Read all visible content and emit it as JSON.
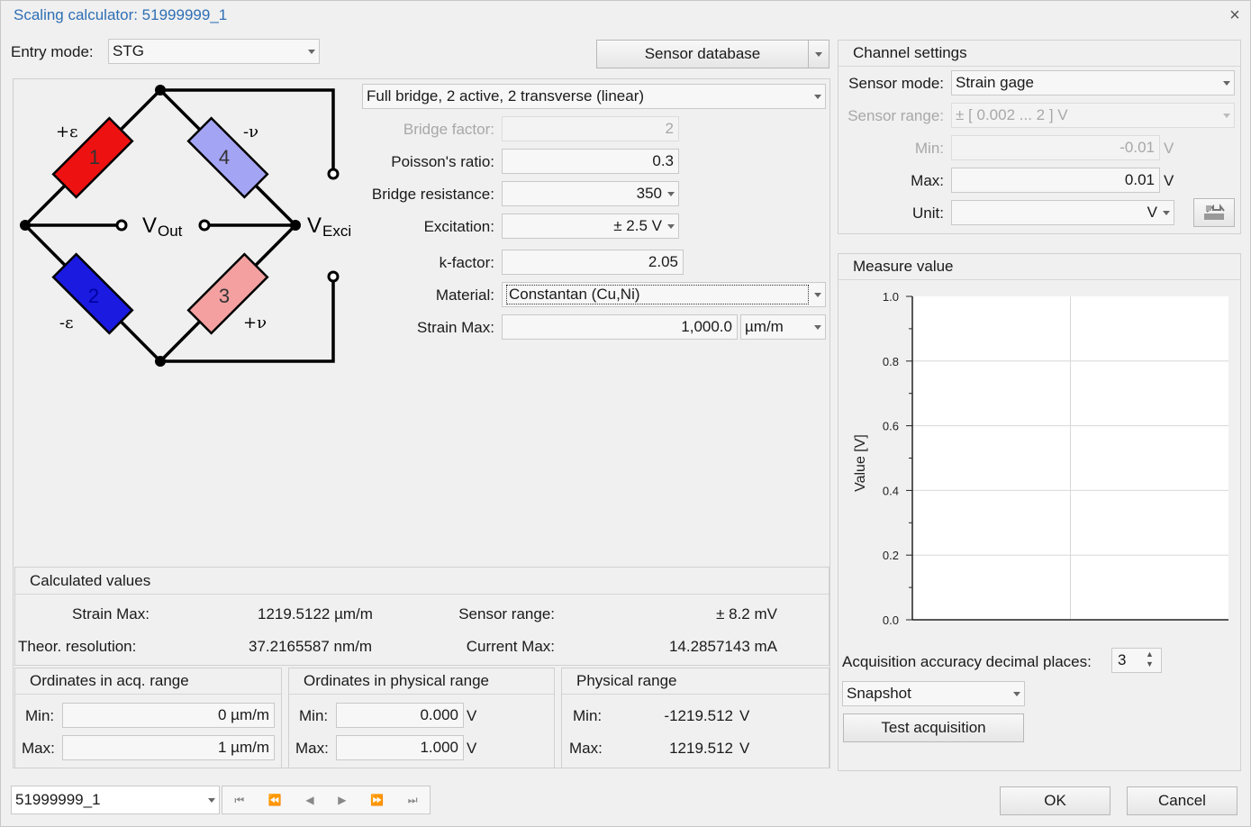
{
  "window": {
    "title": "Scaling calculator: 51999999_1",
    "close": "×"
  },
  "entry": {
    "label": "Entry mode:",
    "value": "STG"
  },
  "sensor_db": {
    "label": "Sensor database"
  },
  "bridge": {
    "type": "Full bridge, 2 active, 2 transverse (linear)",
    "diagram": {
      "g1": "1",
      "g2": "2",
      "g3": "3",
      "g4": "4",
      "pe": "+ε",
      "me": "-ε",
      "mv": "-ν",
      "pv": "+ν",
      "vout": "V",
      "vout_sub": "Out",
      "vexc": "V",
      "vexc_sub": "Exci"
    }
  },
  "params": {
    "bridge_factor": {
      "label": "Bridge factor:",
      "value": "2"
    },
    "poisson": {
      "label": "Poisson's ratio:",
      "value": "0.3"
    },
    "resistance": {
      "label": "Bridge resistance:",
      "value": "350"
    },
    "excitation": {
      "label": "Excitation:",
      "value": "± 2.5 V"
    },
    "kfactor": {
      "label": "k-factor:",
      "value": "2.05"
    },
    "material": {
      "label": "Material:",
      "value": "Constantan (Cu,Ni)"
    },
    "strain_max": {
      "label": "Strain Max:",
      "value": "1,000.0",
      "unit": "µm/m"
    }
  },
  "calc": {
    "title": "Calculated values",
    "strain_max": {
      "label": "Strain Max:",
      "value": "1219.5122 µm/m"
    },
    "resolution": {
      "label": "Theor. resolution:",
      "value": "37.2165587 nm/m"
    },
    "sensor_range": {
      "label": "Sensor range:",
      "value": "± 8.2 mV"
    },
    "current_max": {
      "label": "Current Max:",
      "value": "14.2857143 mA"
    }
  },
  "ord_acq": {
    "title": "Ordinates in acq. range",
    "min_label": "Min:",
    "min": "0 µm/m",
    "max_label": "Max:",
    "max": "1 µm/m"
  },
  "ord_phys": {
    "title": "Ordinates in physical range",
    "min_label": "Min:",
    "min": "0.000",
    "min_unit": "V",
    "max_label": "Max:",
    "max": "1.000",
    "max_unit": "V"
  },
  "phys_range": {
    "title": "Physical range",
    "min_label": "Min:",
    "min": "-1219.512",
    "min_unit": "V",
    "max_label": "Max:",
    "max": "1219.512",
    "max_unit": "V"
  },
  "channel": {
    "title": "Channel settings",
    "sensor_mode": {
      "label": "Sensor mode:",
      "value": "Strain gage"
    },
    "sensor_range": {
      "label": "Sensor range:",
      "value": "± [ 0.002 ... 2 ] V"
    },
    "min": {
      "label": "Min:",
      "value": "-0.01",
      "unit": "V"
    },
    "max": {
      "label": "Max:",
      "value": "0.01",
      "unit": "V"
    },
    "unit": {
      "label": "Unit:",
      "value": "V"
    }
  },
  "measure": {
    "title": "Measure value"
  },
  "chart_data": {
    "type": "line",
    "title": "",
    "ylabel": "Value [V]",
    "xlabel": "",
    "ylim": [
      0,
      1
    ],
    "yticks": [
      "0.0",
      "0.2",
      "0.4",
      "0.6",
      "0.8",
      "1.0"
    ],
    "series": [],
    "grid": true
  },
  "acq": {
    "label": "Acquisition accuracy decimal places:",
    "value": "3",
    "mode": "Snapshot",
    "test": "Test acquisition"
  },
  "footer": {
    "channel": "51999999_1",
    "ok": "OK",
    "cancel": "Cancel"
  },
  "colors": {
    "gauge1": "#ee1111",
    "gauge2": "#1a1ae0",
    "gauge3": "#f4a0a0",
    "gauge4": "#a4a4f4",
    "title": "#2e6fb5"
  }
}
